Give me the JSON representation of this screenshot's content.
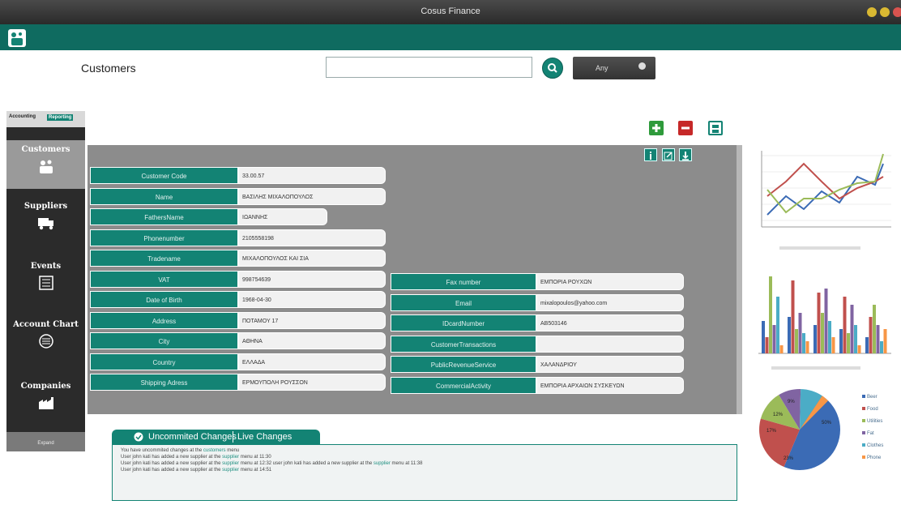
{
  "window": {
    "title": "Cosus Finance"
  },
  "header": {
    "page_title": "Customers"
  },
  "search": {
    "value": "",
    "filter_label": "Any"
  },
  "sidebar": {
    "tabs": [
      "Accounting",
      "Reporting"
    ],
    "items": [
      {
        "label": "Customers",
        "icon": "customers-icon"
      },
      {
        "label": "Suppliers",
        "icon": "truck-icon"
      },
      {
        "label": "Events",
        "icon": "document-icon"
      },
      {
        "label": "Account Chart",
        "icon": "list-icon"
      },
      {
        "label": "Companies",
        "icon": "factory-icon"
      }
    ],
    "footer": "Expand"
  },
  "form": {
    "left": [
      {
        "label": "Customer Code",
        "value": "33.00.57"
      },
      {
        "label": "Name",
        "value": "ΒΑΣΙΛΗΣ ΜΙΧΑΛΟΠΟΥΛΟΣ"
      },
      {
        "label": "FathersName",
        "value": "ΙΩΑΝΝΗΣ"
      },
      {
        "label": "Phonenumber",
        "value": "2105558198"
      },
      {
        "label": "Tradename",
        "value": "ΜΙΧΑΛΟΠΟΥΛΟΣ ΚΑΙ ΣΙΑ"
      },
      {
        "label": "VAT",
        "value": "998754639"
      },
      {
        "label": "Date of Birth",
        "value": "1968-04-30"
      },
      {
        "label": "Address",
        "value": "ΠΟΤΑΜΟΥ 17"
      },
      {
        "label": "City",
        "value": "ΑΘΗΝΑ"
      },
      {
        "label": "Country",
        "value": "ΕΛΛΑΔΑ"
      },
      {
        "label": "Shipping Adress",
        "value": "ΕΡΜΟΥΠΟΛΗ ΡΟΥΣΣΟΝ"
      }
    ],
    "right": [
      {
        "label": "Fax number",
        "value": "ΕΜΠΟΡΙΑ ΡΟΥΧΩΝ"
      },
      {
        "label": "Email",
        "value": "mixalopoulos@yahoo.com"
      },
      {
        "label": "IDcardNumber",
        "value": "ΑΒ503146"
      },
      {
        "label": "CustomerTransactions",
        "value": ""
      },
      {
        "label": "PublicRevenueService",
        "value": "ΧΑΛΑΝΔΡΙΟΥ"
      },
      {
        "label": "CommercialActivity",
        "value": "ΕΜΠΟΡΙΑ ΑΡΧΑΙΩΝ ΣΥΣΚΕΥΩΝ"
      }
    ]
  },
  "log": {
    "tabs": [
      "Uncommited Changes",
      "Live Changes"
    ],
    "lines": [
      [
        "You have uncommited changes at the ",
        "customers",
        " menu"
      ],
      [
        "User john kati has added a new supplier at the ",
        "supplier",
        " menu at 11:30"
      ],
      [
        "User john kati has added a new supplier at the ",
        "supplier",
        " menu at 12:32 user john kati has added a new supplier at the ",
        "supplier",
        " menu at 11:38"
      ],
      [
        "User john kati has added a new supplier at the ",
        "supplier",
        " menu at 14:51"
      ]
    ]
  },
  "colors": {
    "accent": "#138374",
    "header": "#0f6b60",
    "series": [
      "#3b6bb5",
      "#c0504d",
      "#9bbb59",
      "#8064a2",
      "#4bacc6",
      "#f79646"
    ]
  },
  "pie_legend": [
    "Beer",
    "Food",
    "Utilities",
    "Fat",
    "Clothes",
    "Phone"
  ],
  "pie_labels": [
    "50%",
    "23%",
    "17%",
    "12%",
    "9%"
  ]
}
